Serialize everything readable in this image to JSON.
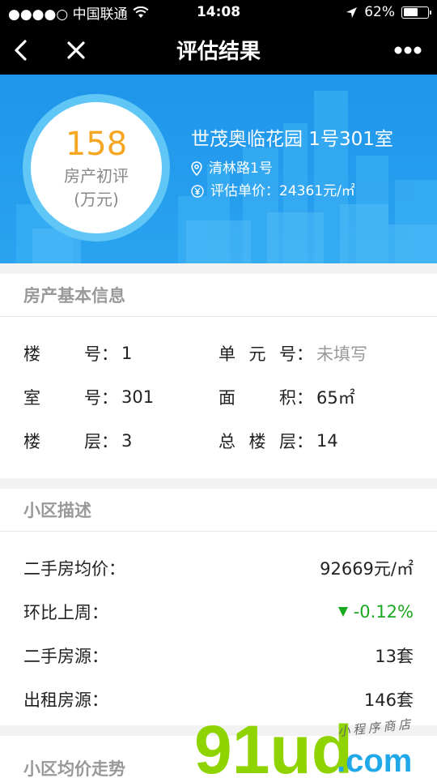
{
  "status_bar": {
    "carrier": "●●●●○ 中国联通",
    "time": "14:08",
    "battery": "62%",
    "battery_level": 0.62
  },
  "nav": {
    "title": "评估结果"
  },
  "hero": {
    "score": "158",
    "score_label": "房产初评",
    "score_unit": "(万元)",
    "name": "世茂奥临花园 1号301室",
    "address": "清林路1号",
    "unit_price": "评估单价：24361元/㎡"
  },
  "basic_info": {
    "title": "房产基本信息",
    "items": [
      {
        "key": "楼号",
        "value": "1",
        "muted": false
      },
      {
        "key": "单元号",
        "value": "未填写",
        "muted": true
      },
      {
        "key": "室号",
        "value": "301",
        "muted": false
      },
      {
        "key": "面积",
        "value": "65㎡",
        "muted": false
      },
      {
        "key": "楼层",
        "value": "3",
        "muted": false
      },
      {
        "key": "总楼层",
        "value": "14",
        "muted": false
      }
    ]
  },
  "community": {
    "title": "小区描述",
    "rows": [
      {
        "label": "二手房均价：",
        "value": "92669元/㎡"
      },
      {
        "label": "环比上周：",
        "value": "-0.12%"
      },
      {
        "label": "二手房源：",
        "value": "13套"
      },
      {
        "label": "出租房源：",
        "value": "146套"
      }
    ]
  },
  "trend": {
    "title": "小区均价走势"
  },
  "watermark": {
    "brand": "91ud",
    "domain": ".com",
    "tagline": "小 程 序 商 店"
  },
  "colors": {
    "hero_blue": "#1f95ea",
    "score_orange": "#f5a623",
    "down_green": "#19a81e",
    "watermark_green": "#8fd400",
    "watermark_blue": "#21a8e8"
  }
}
